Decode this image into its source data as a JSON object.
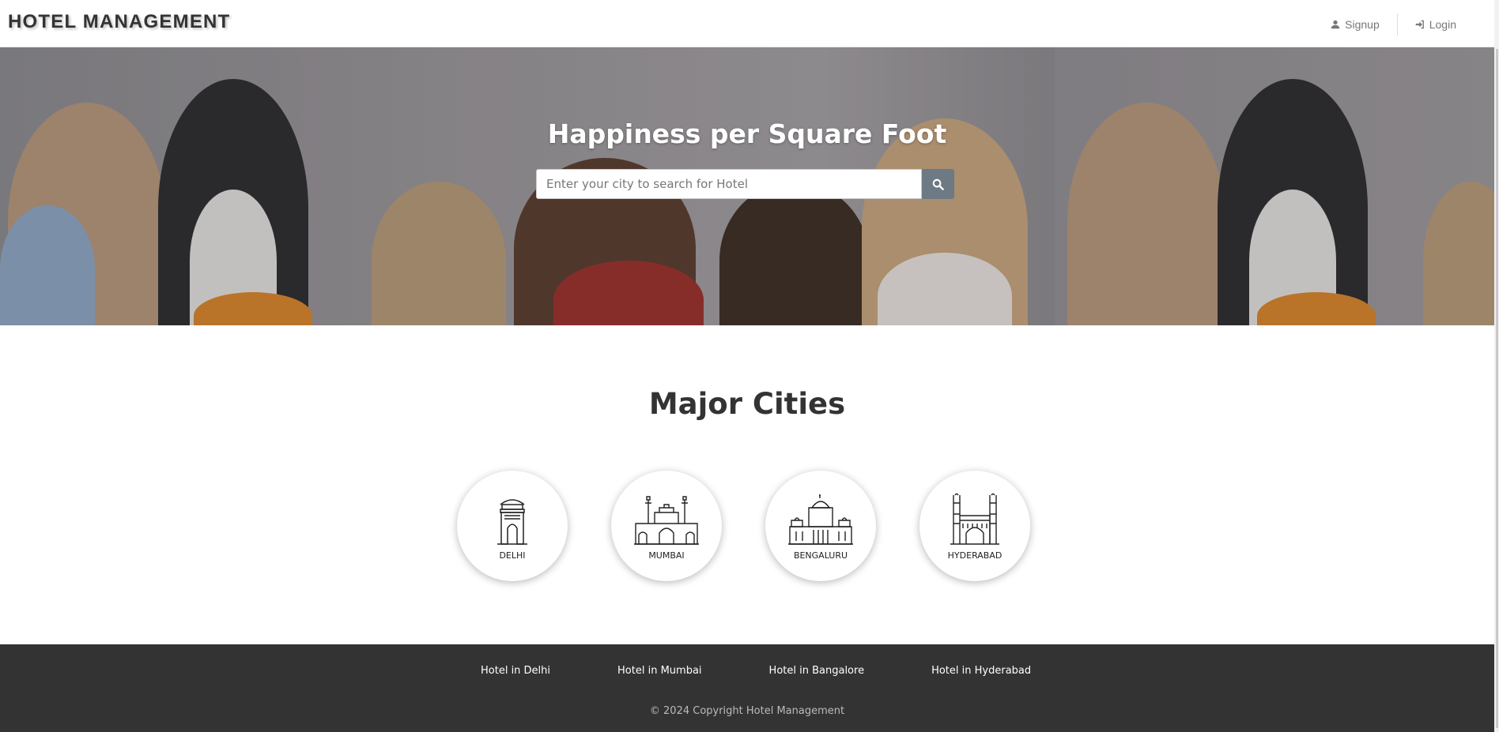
{
  "navbar": {
    "brand": "HOTEL MANAGEMENT",
    "signup_label": "Signup",
    "login_label": "Login"
  },
  "hero": {
    "title": "Happiness per Square Foot",
    "search_placeholder": "Enter your city to search for Hotel",
    "search_icon": "search-icon"
  },
  "cities_section": {
    "title": "Major Cities",
    "cities": [
      {
        "label": "DELHI",
        "icon": "india-gate-icon"
      },
      {
        "label": "MUMBAI",
        "icon": "gateway-of-india-icon"
      },
      {
        "label": "BENGALURU",
        "icon": "vidhana-soudha-icon"
      },
      {
        "label": "HYDERABAD",
        "icon": "charminar-icon"
      }
    ]
  },
  "footer": {
    "links": [
      "Hotel in Delhi",
      "Hotel in Mumbai",
      "Hotel in Bangalore",
      "Hotel in Hyderabad"
    ],
    "copyright": "© 2024 Copyright Hotel Management"
  },
  "colors": {
    "search_button": "#6d7a84",
    "footer_bg": "#333333",
    "hero_tint": "#8c8a8e"
  }
}
